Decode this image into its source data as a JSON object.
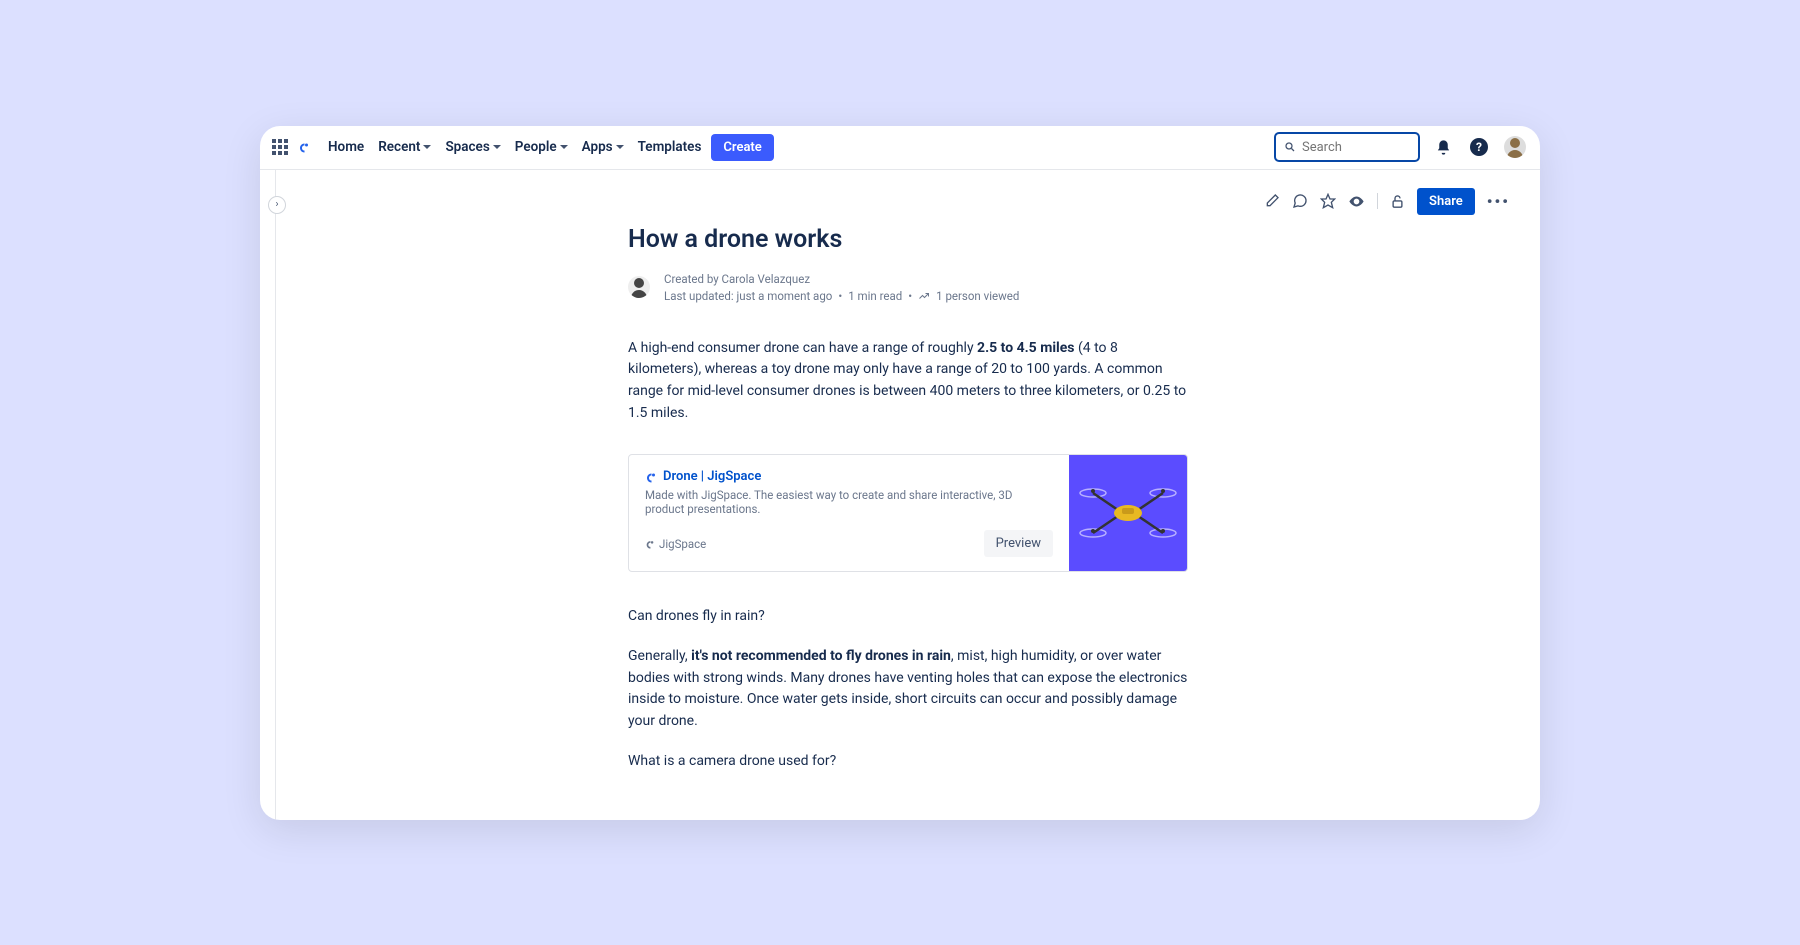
{
  "nav": {
    "home": "Home",
    "recent": "Recent",
    "spaces": "Spaces",
    "people": "People",
    "apps": "Apps",
    "templates": "Templates",
    "create": "Create"
  },
  "search": {
    "placeholder": "Search"
  },
  "toolbar": {
    "share": "Share"
  },
  "page": {
    "title": "How a drone works",
    "created_by_prefix": "Created by ",
    "author": "Carola Velazquez",
    "updated": "Last updated: just a moment ago",
    "read_time": "1 min read",
    "views": "1 person viewed"
  },
  "body": {
    "p1a": "A high-end consumer drone can have a range of roughly ",
    "p1_bold": "2.5 to 4.5 miles",
    "p1b": " (4 to 8 kilometers), whereas a toy drone may only have a range of 20 to 100 yards. A common range for mid-level consumer drones is between 400 meters to three kilometers, or 0.25 to 1.5 miles.",
    "p2": "Can drones fly in rain?",
    "p3a": "Generally, ",
    "p3_bold": "it's not recommended to fly drones in rain",
    "p3b": ", mist, high humidity, or over water bodies with strong winds. Many drones have venting holes that can expose the electronics inside to moisture. Once water gets inside, short circuits can occur and possibly damage your drone.",
    "p4": "What is a camera drone used for?"
  },
  "card": {
    "title": "Drone | JigSpace",
    "desc": "Made with JigSpace. The easiest way to create and share interactive, 3D product presentations.",
    "source": "JigSpace",
    "preview": "Preview"
  }
}
